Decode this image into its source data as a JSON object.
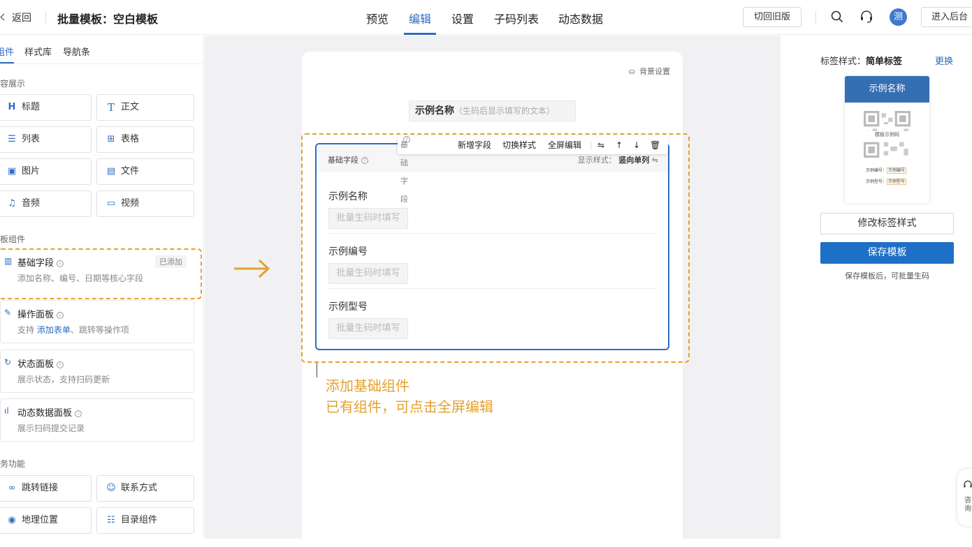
{
  "header": {
    "back_label": "返回",
    "title": "批量模板：空白模板",
    "tabs": [
      "预览",
      "编辑",
      "设置",
      "子码列表",
      "动态数据"
    ],
    "active_tab": "编辑",
    "old_version_button": "切回旧版",
    "avatar_text": "测",
    "admin_button": "进入后台",
    "icons": [
      "search-icon",
      "headset-icon"
    ]
  },
  "left": {
    "tabs": [
      "组件",
      "样式库",
      "导航条"
    ],
    "active_tab": "组件",
    "section_content": "内容展示",
    "content_buttons": [
      {
        "icon": "heading-icon",
        "label": "标题"
      },
      {
        "icon": "text-icon",
        "label": "正文"
      },
      {
        "icon": "list-icon",
        "label": "列表"
      },
      {
        "icon": "table-icon",
        "label": "表格"
      },
      {
        "icon": "image-icon",
        "label": "图片"
      },
      {
        "icon": "file-icon",
        "label": "文件"
      },
      {
        "icon": "music-icon",
        "label": "音频"
      },
      {
        "icon": "video-icon",
        "label": "视频"
      }
    ],
    "section_template": "模板组件",
    "template_cards": [
      {
        "title": "基础字段",
        "desc": "添加名称、编号、日期等核心字段",
        "badge": "已添加"
      },
      {
        "title": "操作面板",
        "desc_prefix": "支持 ",
        "desc_link": "添加表单",
        "desc_suffix": "、跳转等操作项"
      },
      {
        "title": "状态面板",
        "desc": "展示状态，支持扫码更新"
      },
      {
        "title": "动态数据面板",
        "desc": "展示扫码提交记录"
      }
    ],
    "section_business": "业务功能",
    "business_buttons": [
      {
        "icon": "link-icon",
        "label": "跳转链接"
      },
      {
        "icon": "contact-icon",
        "label": "联系方式"
      },
      {
        "icon": "location-icon",
        "label": "地理位置"
      },
      {
        "icon": "catalog-icon",
        "label": "目录组件"
      }
    ]
  },
  "center": {
    "bg_setting": "背景设置",
    "name_tag": "示例名称",
    "name_tag_hint": "（生码后显示填写的文本）",
    "field_box": {
      "title": "基础字段",
      "style_label": "显示样式：",
      "style_value": "竖向单列",
      "fields": [
        {
          "label": "示例名称",
          "placeholder": "批量生码时填写"
        },
        {
          "label": "示例编号",
          "placeholder": "批量生码时填写"
        },
        {
          "label": "示例型号",
          "placeholder": "批量生码时填写"
        }
      ]
    },
    "toolbar": {
      "label": "基础字段",
      "add_field": "新增字段",
      "switch_style": "切换样式",
      "fullscreen_edit": "全屏编辑"
    },
    "annotation_line1": "添加基础组件",
    "annotation_line2": "已有组件，可点击全屏编辑",
    "accent_color": "#e3a12e"
  },
  "right": {
    "label_prefix": "标签样式：",
    "label_value": "简单标签",
    "change_link": "更换",
    "label_card": {
      "header": "示例名称",
      "qr_text": "模板示例码",
      "row1_label": "示例编号：",
      "row1_value": "示例编号",
      "row2_label": "示例型号：",
      "row2_value": "示例型号"
    },
    "modify_button": "修改标签样式",
    "save_button": "保存模板",
    "save_note": "保存模板后，可批量生码"
  },
  "floating": {
    "label": "咨询"
  }
}
